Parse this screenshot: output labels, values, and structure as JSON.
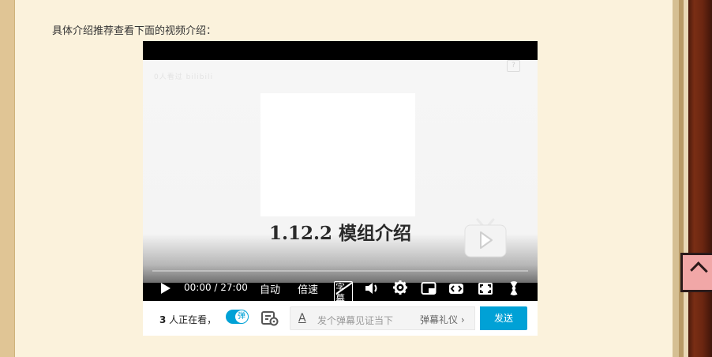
{
  "intro": {
    "text": "具体介绍推荐查看下面的视频介绍："
  },
  "player": {
    "watermark": "0人看过 bilibili",
    "feedback_icon_label": "?",
    "video_title": "1.12.2 模组介绍",
    "controls": {
      "current_time": "00:00",
      "duration": "27:00",
      "time_separator": " / ",
      "quality_label": "自动",
      "speed_label": "倍速",
      "subtitle_label": "字幕"
    },
    "bottom_bar": {
      "viewer_count": "3",
      "viewer_suffix": " 人正在看，",
      "danmaku_toggle_label": "弹",
      "danmaku_placeholder": "发个弹幕见证当下",
      "etiquette_label": "弹幕礼仪 ›",
      "send_label": "发送"
    }
  },
  "colors": {
    "accent": "#00a1d6",
    "page_bg": "#fbf2dc",
    "frame": "#e2c99a",
    "wood": "#6b2611"
  },
  "icons": [
    "play-icon",
    "subtitle-off-icon",
    "volume-icon",
    "gear-icon",
    "picture-in-picture-icon",
    "widescreen-icon",
    "fullscreen-icon",
    "radiation-icon",
    "danmaku-settings-icon",
    "tv-play-icon"
  ]
}
